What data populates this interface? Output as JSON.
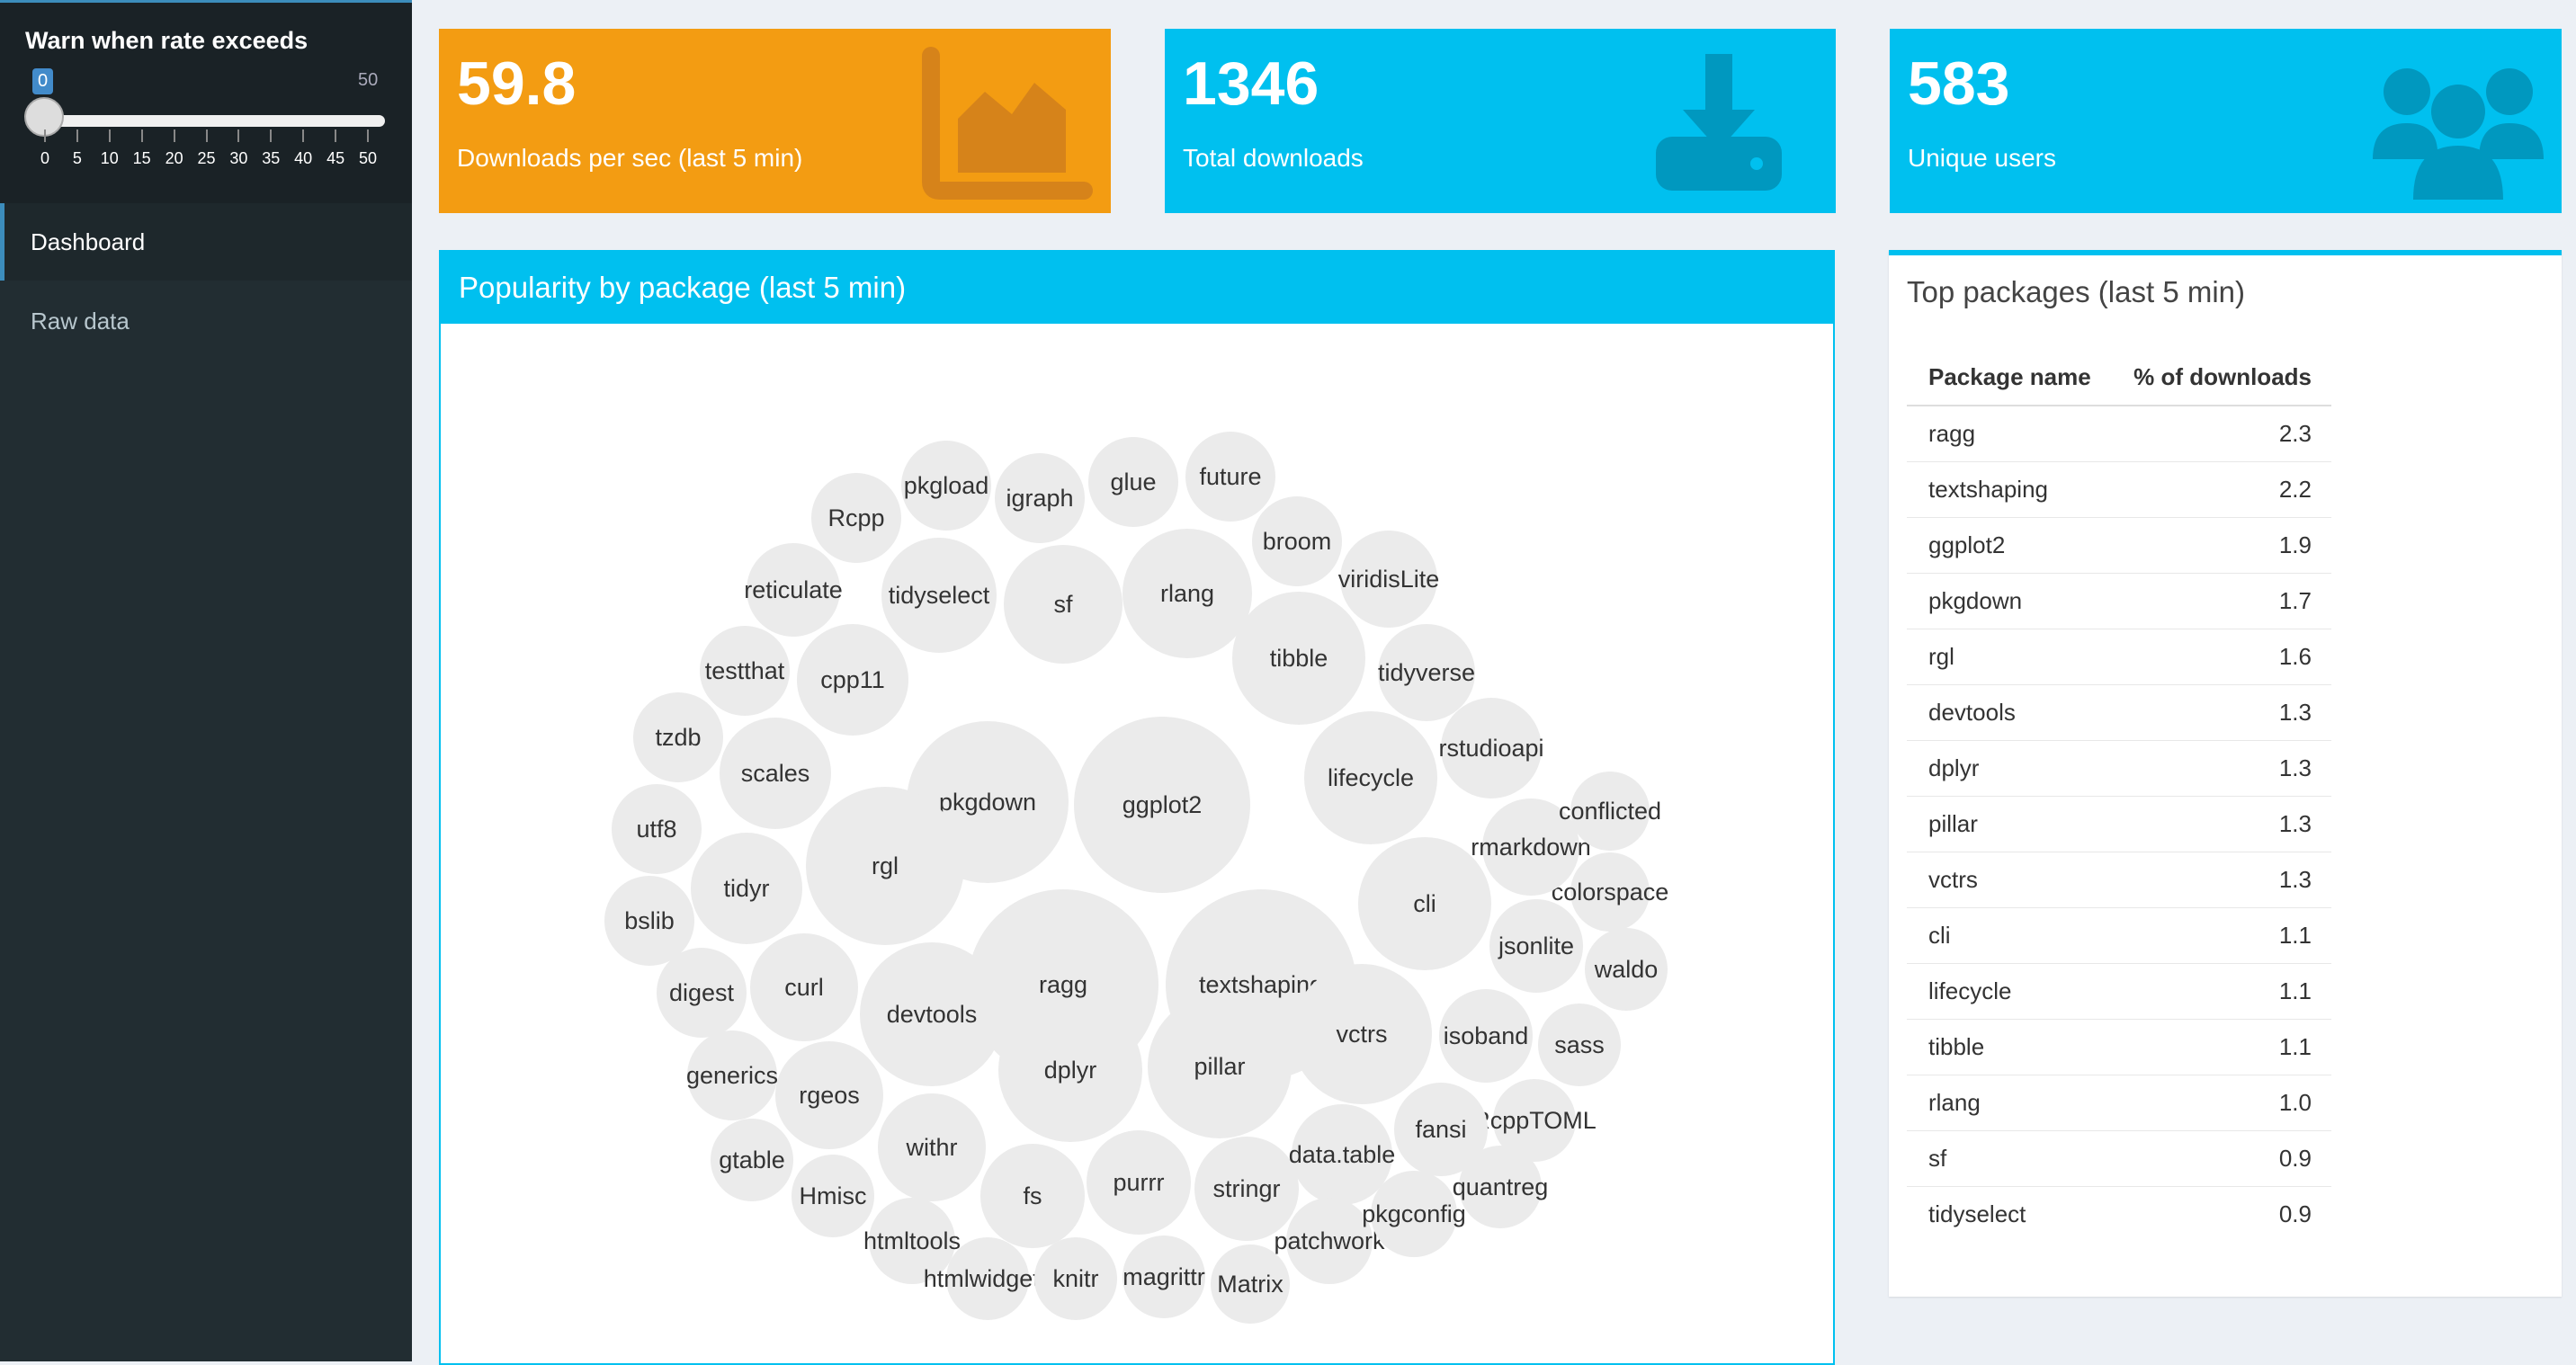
{
  "sidebar": {
    "slider": {
      "label": "Warn when rate exceeds",
      "value": "0",
      "max_label": "50",
      "ticks": [
        "0",
        "5",
        "10",
        "15",
        "20",
        "25",
        "30",
        "35",
        "40",
        "45",
        "50"
      ],
      "level": 0
    },
    "nav": [
      {
        "label": "Dashboard",
        "active": true
      },
      {
        "label": "Raw data",
        "active": false
      }
    ]
  },
  "value_boxes": [
    {
      "value": "59.8",
      "subtitle": "Downloads per sec (last 5 min)",
      "color": "#f39c12",
      "icon": "area-chart-icon"
    },
    {
      "value": "1346",
      "subtitle": "Total downloads",
      "color": "#00c0ef",
      "icon": "download-icon"
    },
    {
      "value": "583",
      "subtitle": "Unique users",
      "color": "#00c0ef",
      "icon": "users-icon"
    }
  ],
  "popularity": {
    "title": "Popularity by package (last 5 min)",
    "bubbles": [
      "ragg",
      "textshaping",
      "ggplot2",
      "pkgdown",
      "rgl",
      "devtools",
      "dplyr",
      "pillar",
      "vctrs",
      "cli",
      "lifecycle",
      "tibble",
      "rlang",
      "sf",
      "tidyselect",
      "cpp11",
      "scales",
      "tidyr",
      "curl",
      "rgeos",
      "withr",
      "fs",
      "purrr",
      "stringr",
      "data.table",
      "Rcpp",
      "pkgload",
      "igraph",
      "glue",
      "future",
      "broom",
      "viridisLite",
      "reticulate",
      "testthat",
      "tidyverse",
      "tzdb",
      "utf8",
      "bslib",
      "digest",
      "generics",
      "gtable",
      "Hmisc",
      "htmltools",
      "htmlwidgets",
      "knitr",
      "magrittr",
      "Matrix",
      "patchwork",
      "pkgconfig",
      "quantreg",
      "RcppTOML",
      "sass",
      "fansi",
      "isoband",
      "waldo",
      "jsonlite",
      "colorspace",
      "rmarkdown",
      "conflicted",
      "rstudioapi"
    ]
  },
  "top_packages": {
    "title": "Top packages (last 5 min)",
    "columns": [
      "Package name",
      "% of downloads"
    ],
    "rows": [
      [
        "ragg",
        "2.3"
      ],
      [
        "textshaping",
        "2.2"
      ],
      [
        "ggplot2",
        "1.9"
      ],
      [
        "pkgdown",
        "1.7"
      ],
      [
        "rgl",
        "1.6"
      ],
      [
        "devtools",
        "1.3"
      ],
      [
        "dplyr",
        "1.3"
      ],
      [
        "pillar",
        "1.3"
      ],
      [
        "vctrs",
        "1.3"
      ],
      [
        "cli",
        "1.1"
      ],
      [
        "lifecycle",
        "1.1"
      ],
      [
        "tibble",
        "1.1"
      ],
      [
        "rlang",
        "1.0"
      ],
      [
        "sf",
        "0.9"
      ],
      [
        "tidyselect",
        "0.9"
      ]
    ]
  }
}
